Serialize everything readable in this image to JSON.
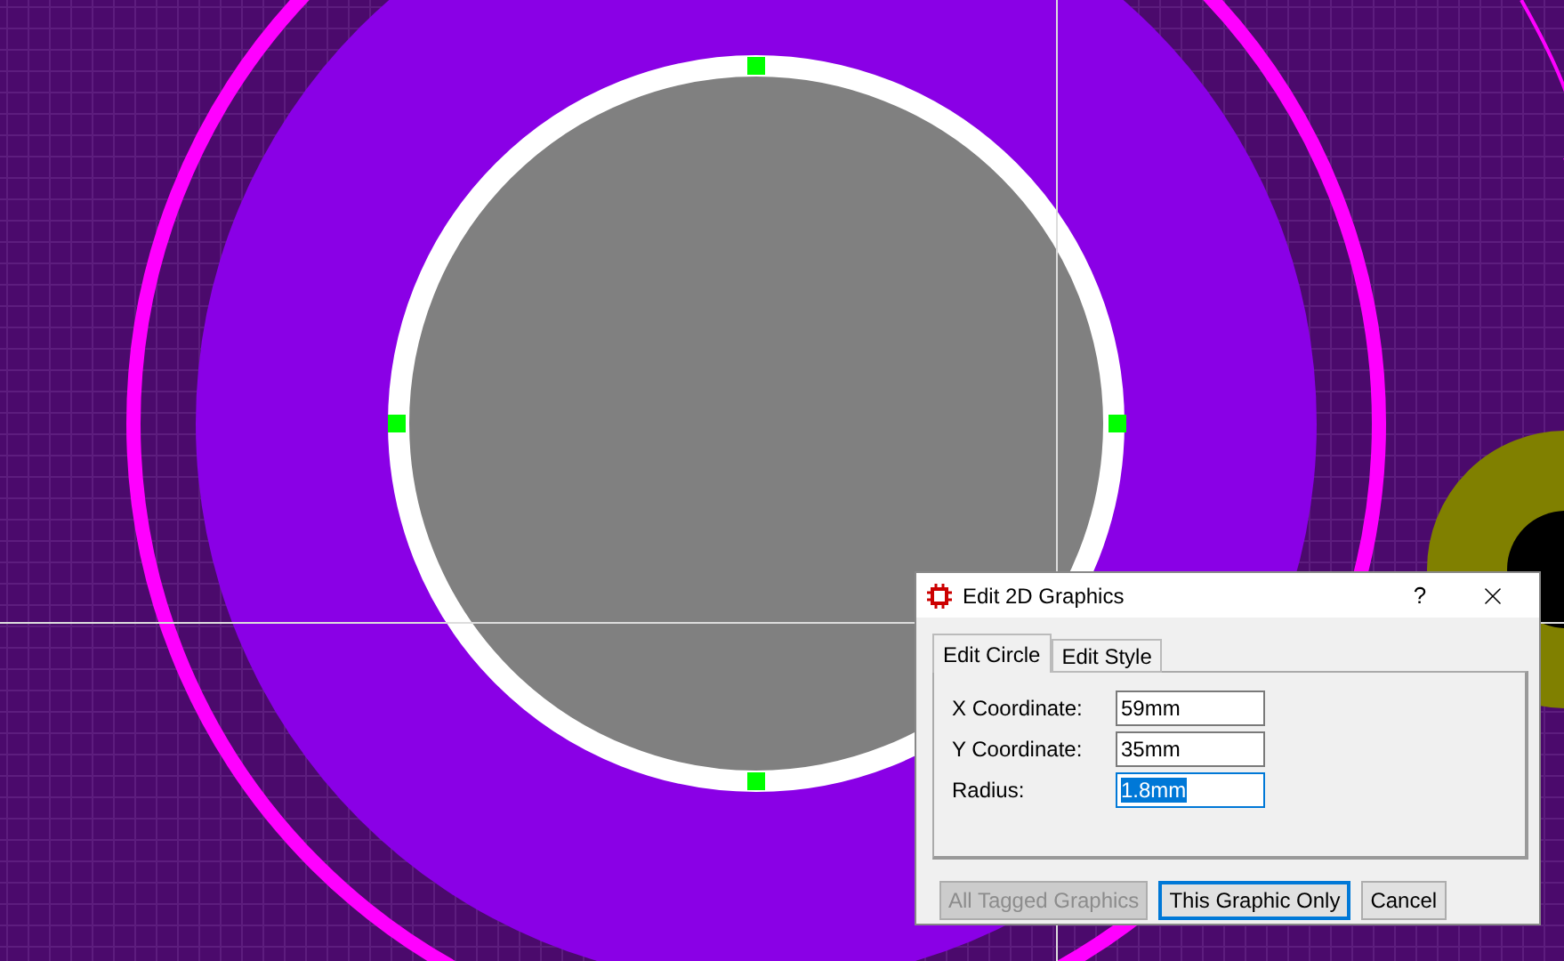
{
  "dialog": {
    "title": "Edit 2D Graphics",
    "help": "?",
    "tabs": [
      {
        "label": "Edit Circle",
        "selected": true
      },
      {
        "label": "Edit Style",
        "selected": false
      }
    ],
    "fields": [
      {
        "label": "X Coordinate:",
        "value": "59mm",
        "focused": false
      },
      {
        "label": "Y Coordinate:",
        "value": "35mm",
        "focused": false
      },
      {
        "label": "Radius:",
        "value": "1.8mm",
        "focused": true
      }
    ],
    "buttons": [
      {
        "label": "All Tagged Graphics",
        "disabled": true,
        "default": false
      },
      {
        "label": "This Graphic Only",
        "disabled": false,
        "default": true
      },
      {
        "label": "Cancel",
        "disabled": false,
        "default": false
      }
    ]
  }
}
